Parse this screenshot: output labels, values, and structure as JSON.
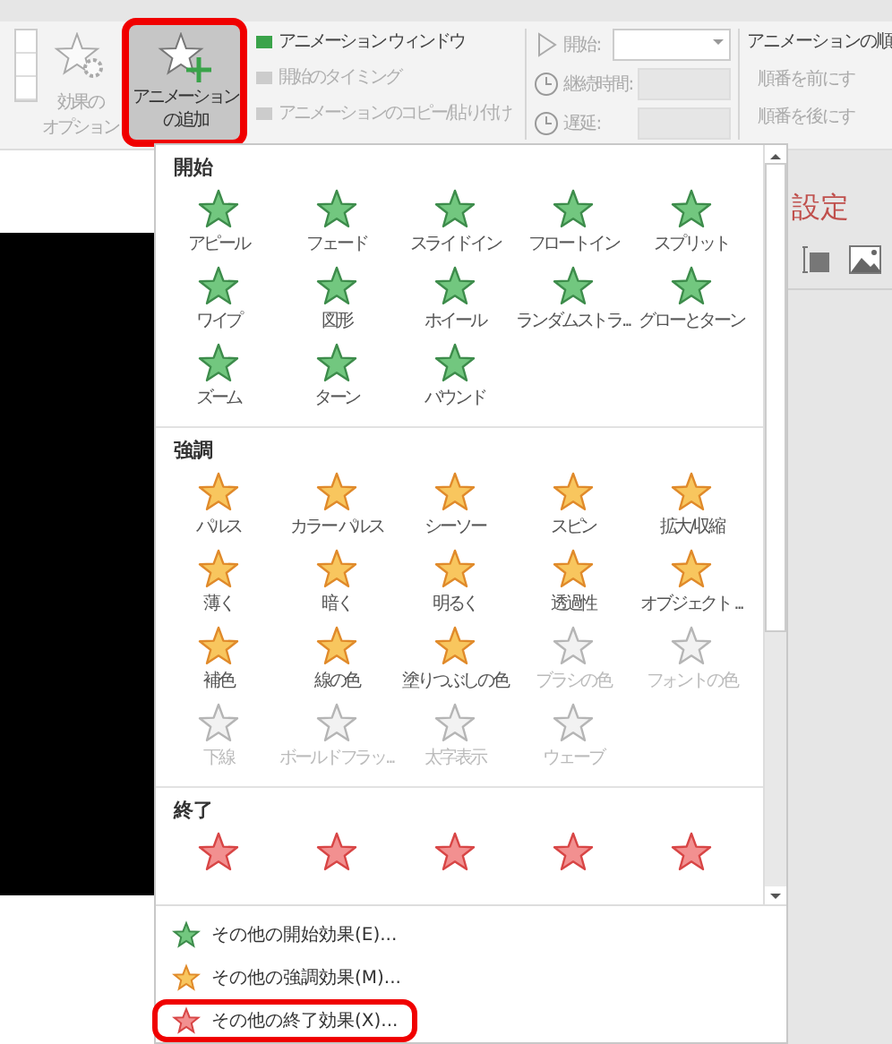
{
  "ribbon": {
    "effect_options": {
      "label_lines": [
        "効果の",
        "オプション"
      ]
    },
    "add_animation": {
      "label_lines": [
        "アニメーション",
        "の追加"
      ],
      "highlighted": true
    },
    "advanced": [
      {
        "label": "アニメーション ウィンドウ",
        "disabled": false
      },
      {
        "label": "開始のタイミング",
        "disabled": true
      },
      {
        "label": "アニメーションのコピー/貼り付け",
        "disabled": true
      }
    ],
    "timing": [
      {
        "label": "開始:",
        "kind": "dropdown"
      },
      {
        "label": "継続時間:",
        "kind": "spinner"
      },
      {
        "label": "遅延:",
        "kind": "spinner"
      }
    ],
    "reorder": {
      "title": "アニメーションの順",
      "items": [
        "順番を前にす",
        "順番を後にす"
      ]
    }
  },
  "gallery": [
    {
      "title": "開始",
      "kind": "entrance",
      "items": [
        {
          "label": "アピール",
          "disabled": false
        },
        {
          "label": "フェード",
          "disabled": false
        },
        {
          "label": "スライドイン",
          "disabled": false
        },
        {
          "label": "フロートイン",
          "disabled": false
        },
        {
          "label": "スプリット",
          "disabled": false
        },
        {
          "label": "ワイプ",
          "disabled": false
        },
        {
          "label": "図形",
          "disabled": false
        },
        {
          "label": "ホイール",
          "disabled": false
        },
        {
          "label": "ランダムストラ...",
          "disabled": false
        },
        {
          "label": "グローとターン",
          "disabled": false
        },
        {
          "label": "ズーム",
          "disabled": false
        },
        {
          "label": "ターン",
          "disabled": false
        },
        {
          "label": "バウンド",
          "disabled": false
        }
      ]
    },
    {
      "title": "強調",
      "kind": "emphasis",
      "items": [
        {
          "label": "パルス",
          "disabled": false
        },
        {
          "label": "カラー パルス",
          "disabled": false
        },
        {
          "label": "シーソー",
          "disabled": false
        },
        {
          "label": "スピン",
          "disabled": false
        },
        {
          "label": "拡大/収縮",
          "disabled": false
        },
        {
          "label": "薄く",
          "disabled": false
        },
        {
          "label": "暗く",
          "disabled": false
        },
        {
          "label": "明るく",
          "disabled": false
        },
        {
          "label": "透過性",
          "disabled": false
        },
        {
          "label": "オブジェクト ...",
          "disabled": false
        },
        {
          "label": "補色",
          "disabled": false
        },
        {
          "label": "線の色",
          "disabled": false
        },
        {
          "label": "塗りつぶしの色",
          "disabled": false
        },
        {
          "label": "ブラシの色",
          "disabled": true
        },
        {
          "label": "フォントの色",
          "disabled": true
        },
        {
          "label": "下線",
          "disabled": true
        },
        {
          "label": "ボールドフラッ...",
          "disabled": true
        },
        {
          "label": "太字表示",
          "disabled": true
        },
        {
          "label": "ウェーブ",
          "disabled": true
        }
      ]
    },
    {
      "title": "終了",
      "kind": "exit",
      "items": [
        {
          "disabled": false
        },
        {
          "disabled": false
        },
        {
          "disabled": false
        },
        {
          "disabled": false
        },
        {
          "disabled": false
        }
      ]
    }
  ],
  "more_effects": [
    {
      "label": "その他の開始効果(E)...",
      "kind": "entrance",
      "highlighted": false
    },
    {
      "label": "その他の強調効果(M)...",
      "kind": "emphasis",
      "highlighted": false
    },
    {
      "label": "その他の終了効果(X)...",
      "kind": "exit",
      "highlighted": true
    }
  ],
  "side_pane": {
    "title": "設定"
  }
}
